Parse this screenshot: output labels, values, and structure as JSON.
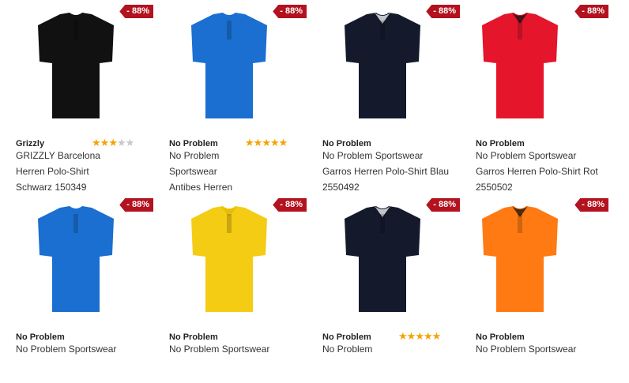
{
  "products": [
    {
      "badge": "- 88%",
      "brand": "Grizzly",
      "rating": 3,
      "lines": [
        "GRIZZLY Barcelona",
        "Herren Polo-Shirt",
        "Schwarz 150349"
      ],
      "color": "#111111",
      "accent": "#111111"
    },
    {
      "badge": "- 88%",
      "brand": "No Problem",
      "rating": 5,
      "lines": [
        "No Problem",
        "Sportswear",
        "Antibes Herren"
      ],
      "color": "#1a6fd0",
      "accent": "#1a6fd0"
    },
    {
      "badge": "- 88%",
      "brand": "No Problem",
      "rating": 0,
      "lines": [
        "No Problem Sportswear",
        "Garros Herren Polo-Shirt Blau",
        "2550492"
      ],
      "color": "#141a2c",
      "accent": "#ffffff"
    },
    {
      "badge": "- 88%",
      "brand": "No Problem",
      "rating": 0,
      "lines": [
        "No Problem Sportswear",
        "Garros Herren Polo-Shirt Rot",
        "2550502"
      ],
      "color": "#e5152c",
      "accent": "#111111"
    },
    {
      "badge": "- 88%",
      "brand": "No Problem",
      "rating": 0,
      "lines": [
        "No Problem Sportswear"
      ],
      "color": "#1a6fd0",
      "accent": "#1a6fd0"
    },
    {
      "badge": "- 88%",
      "brand": "No Problem",
      "rating": 0,
      "lines": [
        "No Problem Sportswear"
      ],
      "color": "#f5cc14",
      "accent": "#e0b800"
    },
    {
      "badge": "- 88%",
      "brand": "No Problem",
      "rating": 5,
      "lines": [
        "No Problem"
      ],
      "color": "#141a2c",
      "accent": "#ffffff"
    },
    {
      "badge": "- 88%",
      "brand": "No Problem",
      "rating": 0,
      "lines": [
        "No Problem Sportswear"
      ],
      "color": "#ff7a12",
      "accent": "#111111"
    }
  ]
}
